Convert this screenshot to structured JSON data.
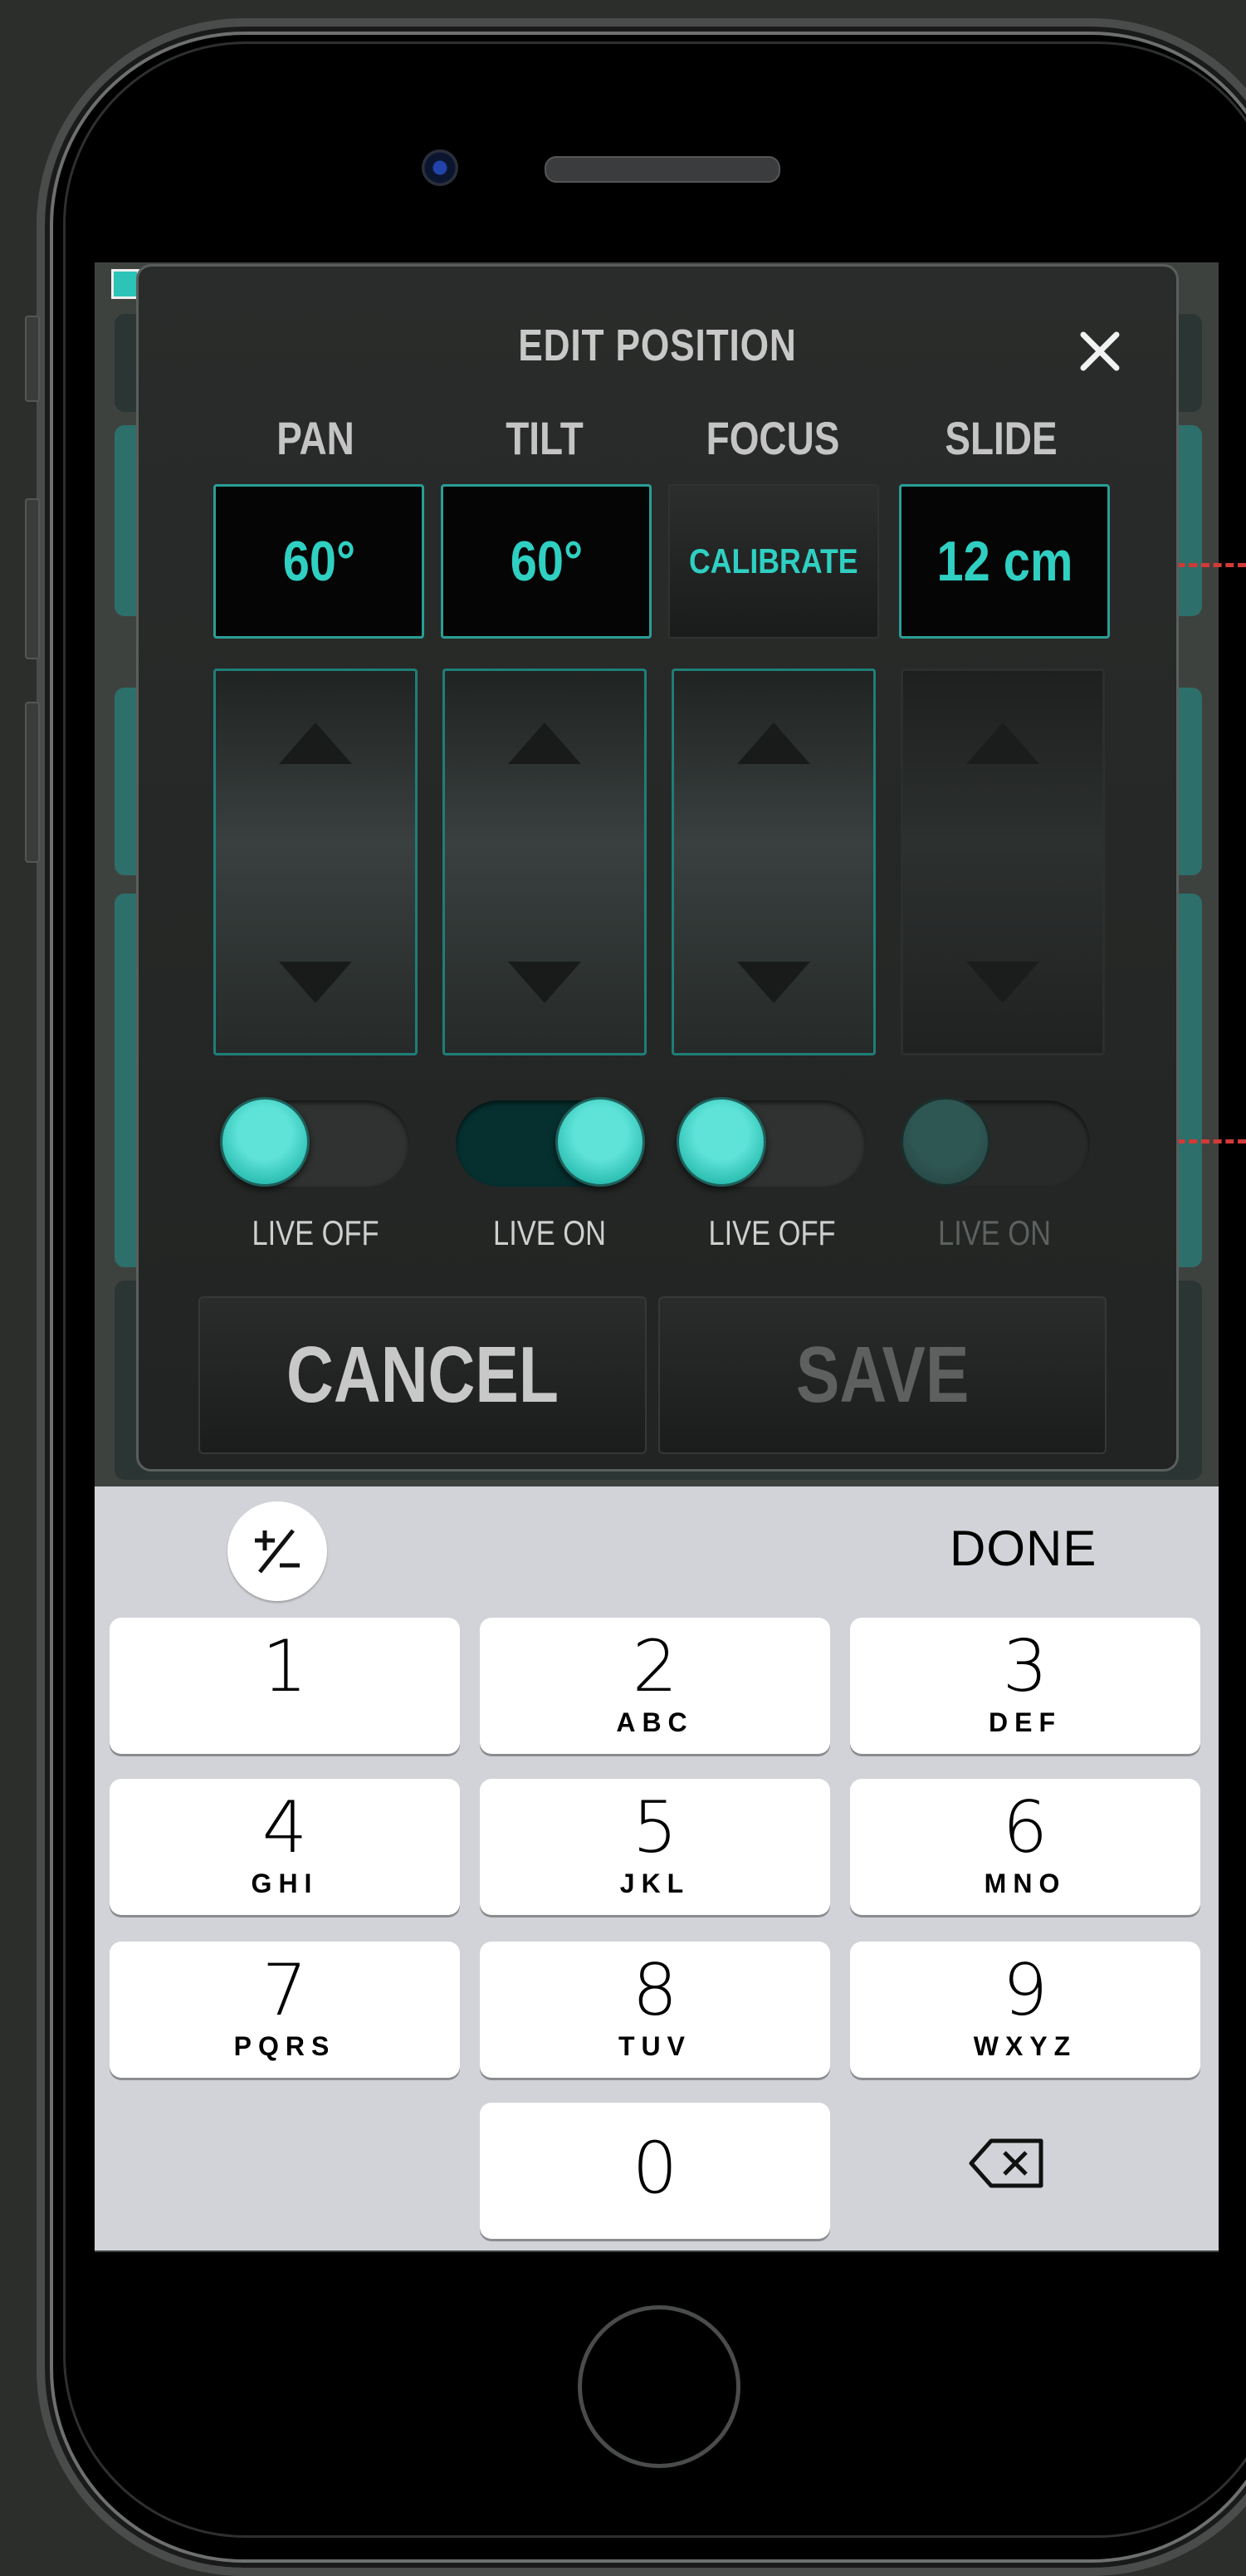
{
  "modal": {
    "title": "EDIT POSITION",
    "columns": [
      {
        "label": "PAN",
        "value": "60°",
        "live_label": "LIVE OFF",
        "live": false
      },
      {
        "label": "TILT",
        "value": "60°",
        "live_label": "LIVE ON",
        "live": true
      },
      {
        "label": "FOCUS",
        "value": "CALIBRATE",
        "live_label": "LIVE OFF",
        "live": false
      },
      {
        "label": "SLIDE",
        "value": "12 cm",
        "live_label": "LIVE ON",
        "live": false
      }
    ],
    "cancel_label": "CANCEL",
    "save_label": "SAVE"
  },
  "keyboard": {
    "plus_minus": "+/-",
    "done_label": "DONE",
    "keys": [
      {
        "num": "1",
        "letters": ""
      },
      {
        "num": "2",
        "letters": "ABC"
      },
      {
        "num": "3",
        "letters": "DEF"
      },
      {
        "num": "4",
        "letters": "GHI"
      },
      {
        "num": "5",
        "letters": "JKL"
      },
      {
        "num": "6",
        "letters": "MNO"
      },
      {
        "num": "7",
        "letters": "PQRS"
      },
      {
        "num": "8",
        "letters": "TUV"
      },
      {
        "num": "9",
        "letters": "WXYZ"
      },
      {
        "num": "0",
        "letters": ""
      }
    ]
  },
  "colors": {
    "accent": "#2fd0c2",
    "annotation": "#d23a36",
    "modal_bg": "#242625",
    "keyboard_bg": "#d1d3d8"
  }
}
